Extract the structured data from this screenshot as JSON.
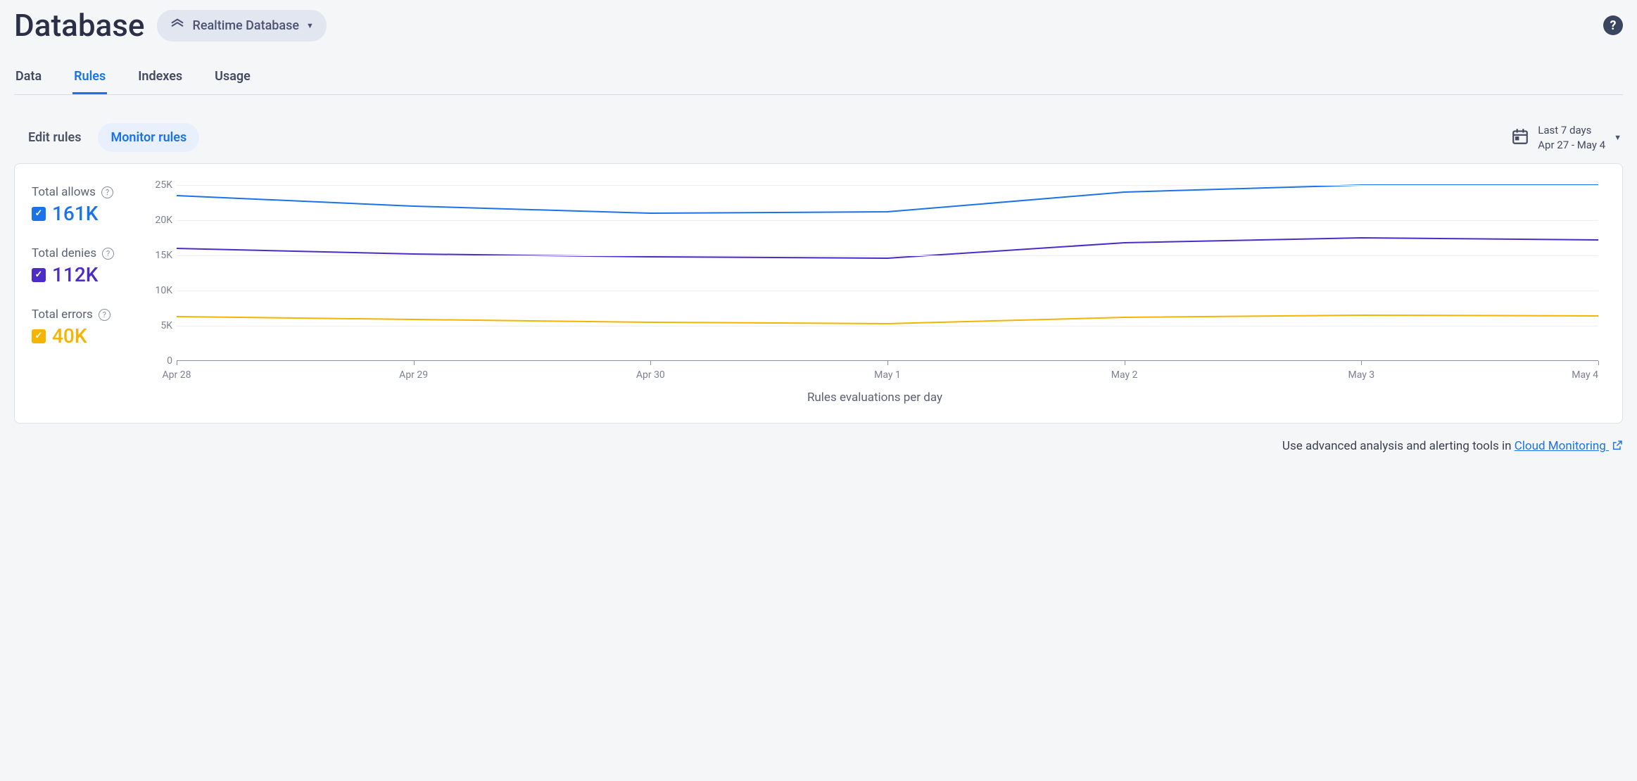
{
  "header": {
    "title": "Database",
    "selector_label": "Realtime Database"
  },
  "tabs": [
    "Data",
    "Rules",
    "Indexes",
    "Usage"
  ],
  "active_tab": 1,
  "subtools": {
    "edit": "Edit rules",
    "monitor": "Monitor rules",
    "active": "monitor"
  },
  "date_picker": {
    "range_label": "Last 7 days",
    "range_dates": "Apr 27 - May 4"
  },
  "legend": {
    "allows": {
      "label": "Total allows",
      "value": "161K",
      "color": "#1a73e8"
    },
    "denies": {
      "label": "Total denies",
      "value": "112K",
      "color": "#4b2cc9"
    },
    "errors": {
      "label": "Total errors",
      "value": "40K",
      "color": "#f4b400"
    }
  },
  "chart_data": {
    "type": "line",
    "xlabel": "Rules evaluations per day",
    "ylabel": "",
    "ylim": [
      0,
      25000
    ],
    "y_ticks": [
      0,
      5000,
      10000,
      15000,
      20000,
      25000
    ],
    "y_tick_labels": [
      "0",
      "5K",
      "10K",
      "15K",
      "20K",
      "25K"
    ],
    "categories": [
      "Apr 28",
      "Apr 29",
      "Apr 30",
      "May 1",
      "May 2",
      "May 3",
      "May 4"
    ],
    "series": [
      {
        "name": "Total allows",
        "color": "#1a73e8",
        "values": [
          23500,
          22000,
          21000,
          21200,
          24000,
          25000,
          25000
        ]
      },
      {
        "name": "Total denies",
        "color": "#4b2cc9",
        "values": [
          16000,
          15200,
          14800,
          14600,
          16800,
          17500,
          17200
        ]
      },
      {
        "name": "Total errors",
        "color": "#f4b400",
        "values": [
          6300,
          5900,
          5500,
          5300,
          6200,
          6500,
          6400
        ]
      }
    ]
  },
  "footer": {
    "text_prefix": "Use advanced analysis and alerting tools in ",
    "link_text": "Cloud Monitoring"
  }
}
